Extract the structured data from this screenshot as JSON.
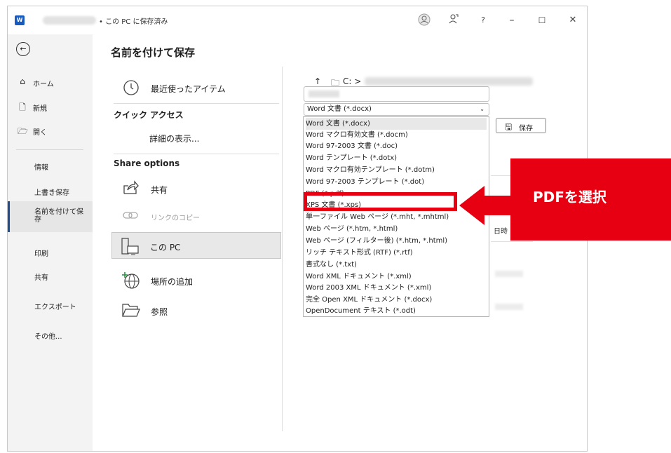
{
  "window": {
    "title_status": "• この PC に保存済み",
    "help": "?"
  },
  "nav": {
    "items": [
      {
        "label": "ホーム",
        "icon": "home-icon"
      },
      {
        "label": "新規",
        "icon": "new-document-icon"
      },
      {
        "label": "開く",
        "icon": "open-folder-icon"
      },
      {
        "label": "情報"
      },
      {
        "label": "上書き保存"
      },
      {
        "label": "名前を付けて保存"
      },
      {
        "label": "印刷"
      },
      {
        "label": "共有"
      },
      {
        "label": "エクスポート"
      },
      {
        "label": "その他..."
      }
    ]
  },
  "page_title": "名前を付けて保存",
  "locations": {
    "recent": "最近使ったアイテム",
    "quick_access": "クイック アクセス",
    "show_more": "詳細の表示...",
    "share_options": "Share options",
    "share": "共有",
    "copy_link": "リンクのコピー",
    "this_pc": "この PC",
    "add_place": "場所の追加",
    "browse": "参照"
  },
  "save_panel": {
    "path_prefix": "C: >",
    "file_type_selected": "Word 文書 (*.docx)",
    "save_label": "保存",
    "behind_column": "日時"
  },
  "file_types": [
    "Word 文書 (*.docx)",
    "Word マクロ有効文書 (*.docm)",
    "Word 97-2003 文書 (*.doc)",
    "Word テンプレート (*.dotx)",
    "Word マクロ有効テンプレート (*.dotm)",
    "Word 97-2003 テンプレート (*.dot)",
    "PDF (*.pdf)",
    "XPS 文書 (*.xps)",
    "単一ファイル Web ページ (*.mht, *.mhtml)",
    "Web ページ (*.htm, *.html)",
    "Web ページ (フィルター後) (*.htm, *.html)",
    "リッチ テキスト形式 (RTF) (*.rtf)",
    "書式なし (*.txt)",
    "Word XML ドキュメント (*.xml)",
    "Word 2003 XML ドキュメント (*.xml)",
    "完全 Open XML ドキュメント (*.docx)",
    "OpenDocument テキスト (*.odt)"
  ],
  "callout": {
    "text": "PDFを選択",
    "color": "#e60012"
  }
}
